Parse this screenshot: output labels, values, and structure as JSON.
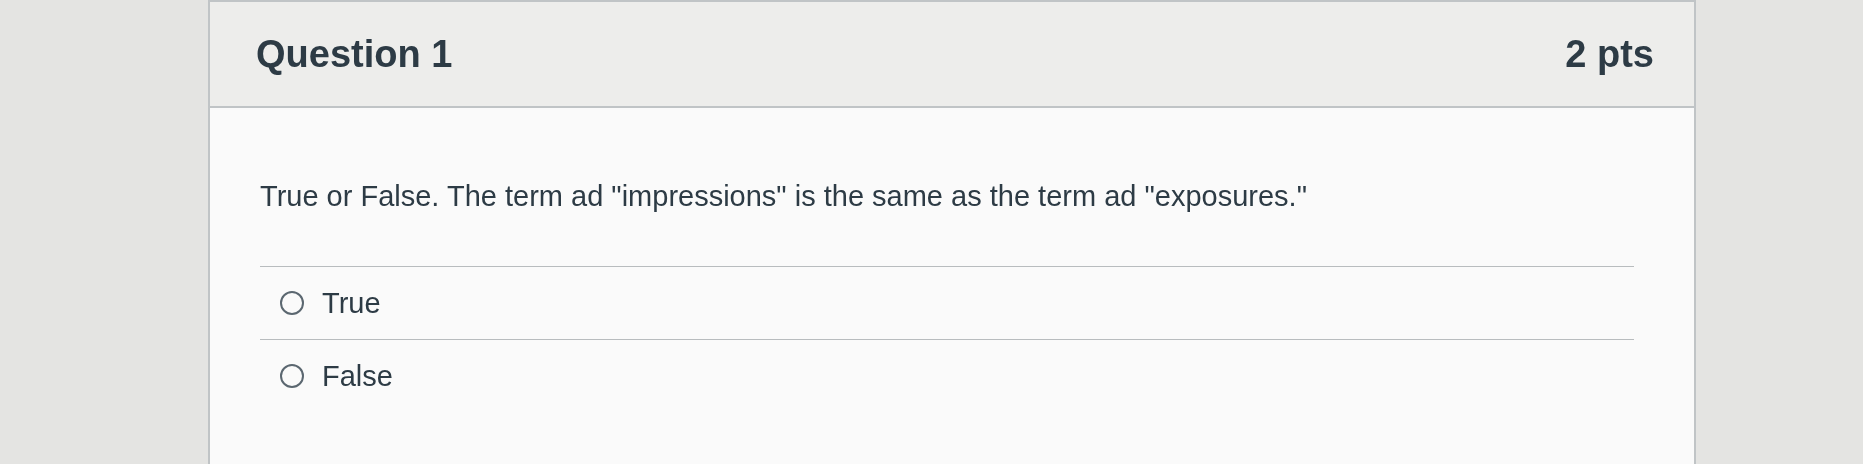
{
  "question": {
    "title": "Question 1",
    "points": "2 pts",
    "text": "True or False. The term ad \"impressions\" is the same as the term ad \"exposures.\"",
    "options": [
      {
        "label": "True",
        "selected": false
      },
      {
        "label": "False",
        "selected": false
      }
    ]
  }
}
